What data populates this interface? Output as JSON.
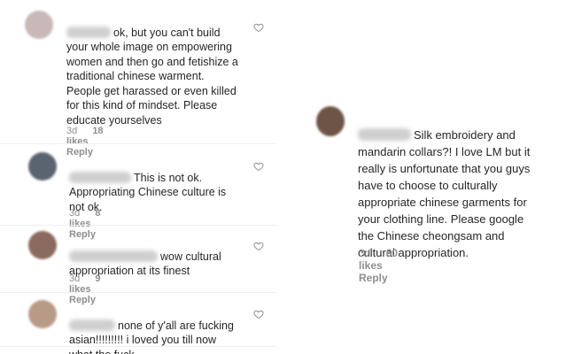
{
  "comments_left": [
    {
      "text": "ok, but you can't build\nyour whole image on empowering\nwomen and then go and fetishize a\ntraditional chinese warment.\nPeople get harassed or even killed\nfor this kind of mindset. Please\neducate yourselves",
      "time": "3d",
      "likes": "18 likes",
      "reply": "Reply",
      "avatar_color": "#c9b8b8"
    },
    {
      "text": "This is not ok.\nAppropriating Chinese culture is\nnot ok.",
      "time": "3d",
      "likes": "8 likes",
      "reply": "Reply",
      "avatar_color": "#5a6470"
    },
    {
      "text": "wow cultural\nappropriation at its finest",
      "time": "3d",
      "likes": "9 likes",
      "reply": "Reply",
      "avatar_color": "#8a6a5e"
    },
    {
      "text": "none of y'all are fucking\nasian!!!!!!!!! i loved you till now\nwhat the fuck",
      "avatar_color": "#b89a86"
    }
  ],
  "comment_right": {
    "text": "Silk embroidery and\nmandarin collars?! I love LM but it\nreally is unfortunate that you guys\nhave to choose to culturally\nappropriate chinese garments for\nyour clothing line. Please google\nthe Chinese cheongsam and\ncultural appropriation.",
    "time": "3d",
    "likes": "60 likes",
    "reply": "Reply",
    "avatar_color": "#6e5446"
  },
  "icons": {
    "like": "heart-outline-icon"
  }
}
